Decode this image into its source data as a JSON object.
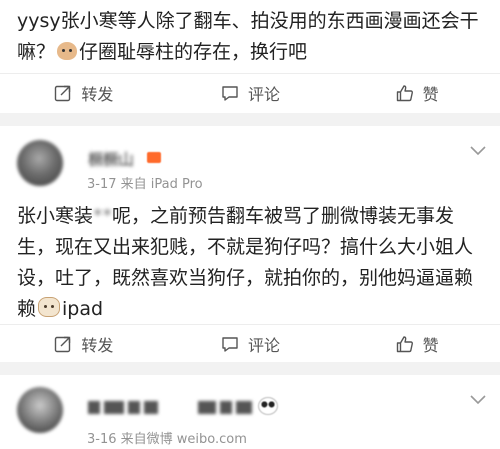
{
  "comments": [
    {
      "text_before": "yysy张小寒等人除了翻车、拍没用的东西画漫画还会干嘛？",
      "emoji": "dog-face",
      "text_after": "仔圈耻辱柱的存在，换行吧",
      "actions": {
        "repost": "转发",
        "comment": "评论",
        "like": "赞"
      }
    },
    {
      "nickname": "橛橛山",
      "meta": "3-17  来自 iPad Pro",
      "text_before": "张小寒装",
      "text_censored": "**",
      "text_after": "呢，之前预告翻车被骂了删微博装无事发生，现在又出来犯贱，不就是狗仔吗？搞什么大小姐人设，吐了，既然喜欢当狗仔，就拍你的，别他妈逼逼赖赖",
      "emoji": "cat-face",
      "text_tail": "ipad",
      "actions": {
        "repost": "转发",
        "comment": "评论",
        "like": "赞"
      }
    },
    {
      "meta": "3-16  来自微博 weibo.com"
    }
  ],
  "colors": {
    "badge": "#ff6a2b",
    "meta": "#939393",
    "background": "#f2f2f2"
  },
  "icons": [
    "repost-icon",
    "comment-icon",
    "like-icon",
    "chevron-down-icon"
  ]
}
